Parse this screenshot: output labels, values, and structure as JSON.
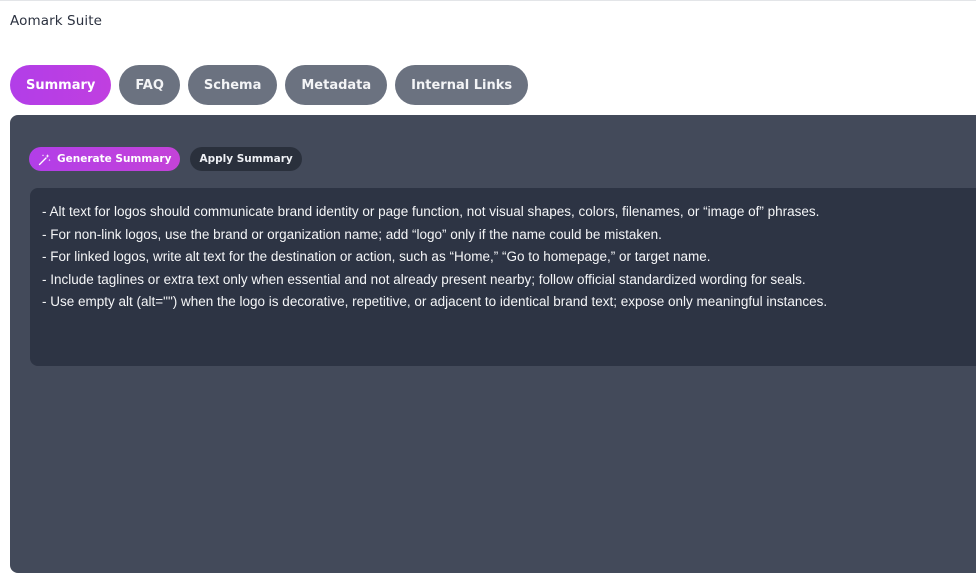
{
  "app": {
    "title": "Aomark Suite"
  },
  "tabs": [
    {
      "label": "Summary",
      "active": true
    },
    {
      "label": "FAQ",
      "active": false
    },
    {
      "label": "Schema",
      "active": false
    },
    {
      "label": "Metadata",
      "active": false
    },
    {
      "label": "Internal Links",
      "active": false
    }
  ],
  "actions": {
    "generate_label": "Generate Summary",
    "generate_icon": "magic-wand-icon",
    "apply_label": "Apply Summary"
  },
  "summary": {
    "lines": [
      "- Alt text for logos should communicate brand identity or page function, not visual shapes, colors, filenames, or “image of” phrases.",
      "- For non-link logos, use the brand or organization name; add “logo” only if the name could be mistaken.",
      "- For linked logos, write alt text for the destination or action, such as “Home,” “Go to homepage,” or target name.",
      "- Include taglines or extra text only when essential and not already present nearby; follow official standardized wording for seals.",
      "- Use empty alt (alt=\"\") when the logo is decorative, repetitive, or adjacent to identical brand text; expose only meaningful instances."
    ]
  },
  "colors": {
    "accent": "#b23ee8",
    "tab_inactive": "#6b7280",
    "panel_bg": "#434a5a",
    "summary_bg": "#2d3444",
    "apply_bg": "#2a303c"
  }
}
